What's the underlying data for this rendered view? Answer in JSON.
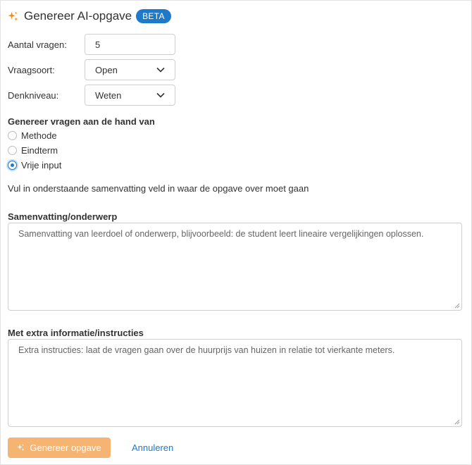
{
  "header": {
    "title": "Genereer AI-opgave",
    "badge": "BETA"
  },
  "fields": {
    "question_count": {
      "label": "Aantal vragen:",
      "value": "5"
    },
    "question_type": {
      "label": "Vraagsoort:",
      "value": "Open"
    },
    "thinking_level": {
      "label": "Denkniveau:",
      "value": "Weten"
    }
  },
  "generate_from": {
    "title": "Genereer vragen aan de hand van",
    "options": [
      "Methode",
      "Eindterm",
      "Vrije input"
    ],
    "selected": "Vrije input"
  },
  "hint": "Vul in onderstaande samenvatting veld in waar de opgave over moet gaan",
  "summary": {
    "label": "Samenvatting/onderwerp",
    "placeholder": "Samenvatting van leerdoel of onderwerp, blijvoorbeeld: de student leert lineaire vergelijkingen oplossen."
  },
  "extra": {
    "label": "Met extra informatie/instructies",
    "placeholder": "Extra instructies: laat de vragen gaan over de huurprijs van huizen in relatie tot vierkante meters."
  },
  "actions": {
    "generate": "Genereer opgave",
    "cancel": "Annuleren"
  },
  "colors": {
    "accent": "#1f79c9",
    "primary_button": "#f5b472",
    "sparkle": "#f08a24"
  }
}
